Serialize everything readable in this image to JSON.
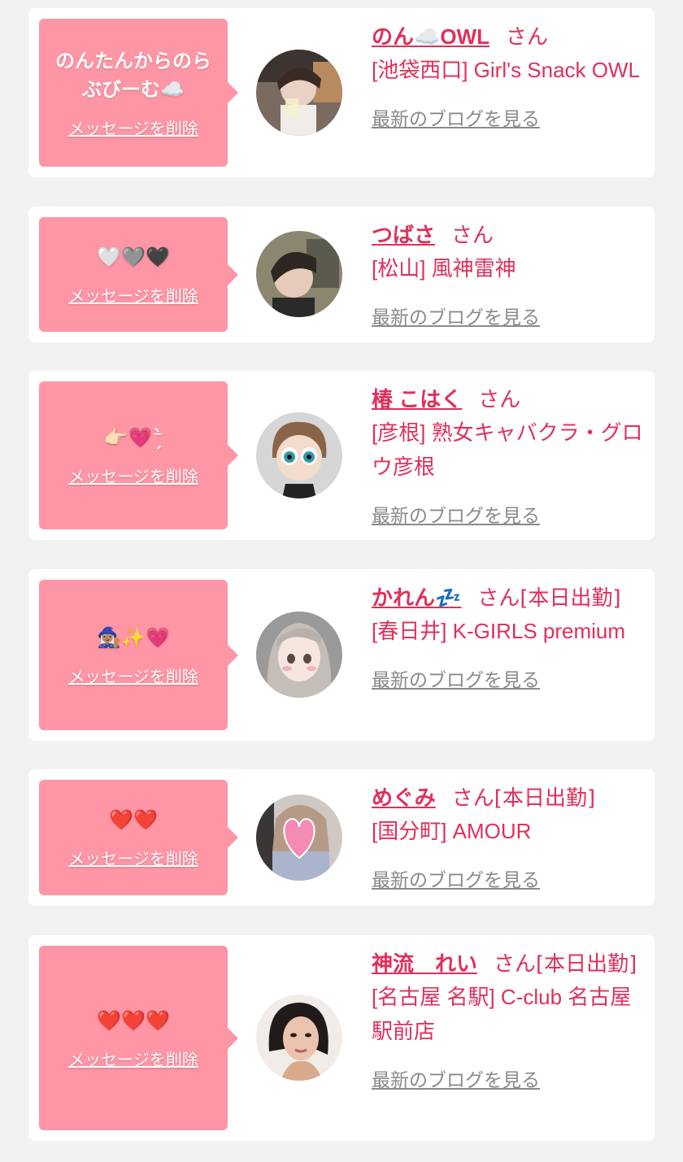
{
  "delete_label": "メッセージを削除",
  "blog_label": "最新のブログを見る",
  "san_label": "さん",
  "colors": {
    "accent": "#e0305a",
    "bubble": "#fe96a5",
    "background": "#f2f2f2",
    "link_gray": "#8a8a8a"
  },
  "messages": [
    {
      "message": "のんたんからのらぶびーむ☁️",
      "name": "のん☁️OWL",
      "status": "",
      "shop": "[池袋西口] Girl's Snack OWL",
      "avatar_icon": "girl-photo-avatar"
    },
    {
      "message": "🤍🩶🖤",
      "name": "つばさ",
      "status": "",
      "shop": "[松山] 風神雷神",
      "avatar_icon": "girl-photo-avatar"
    },
    {
      "message": "👉🏻💗⁻̗̀",
      "name": "椿 こはく",
      "status": "",
      "shop": "[彦根] 熟女キャバクラ・グロウ彦根",
      "avatar_icon": "cartoon-avatar"
    },
    {
      "message": "🧙🏽‍♀️✨💗",
      "name": "かれん💤",
      "status": "[本日出勤]",
      "shop": "[春日井] K-GIRLS premium",
      "avatar_icon": "illustrated-girl-avatar"
    },
    {
      "message": "❤️❤️",
      "name": "めぐみ",
      "status": "[本日出勤]",
      "shop": "[国分町] AMOUR",
      "avatar_icon": "heart-covered-photo-avatar"
    },
    {
      "message": "❤️❤️❤️",
      "name": "神流　れい",
      "status": "[本日出勤]",
      "shop": "[名古屋 名駅] C-club 名古屋駅前店",
      "avatar_icon": "girl-photo-avatar"
    }
  ]
}
